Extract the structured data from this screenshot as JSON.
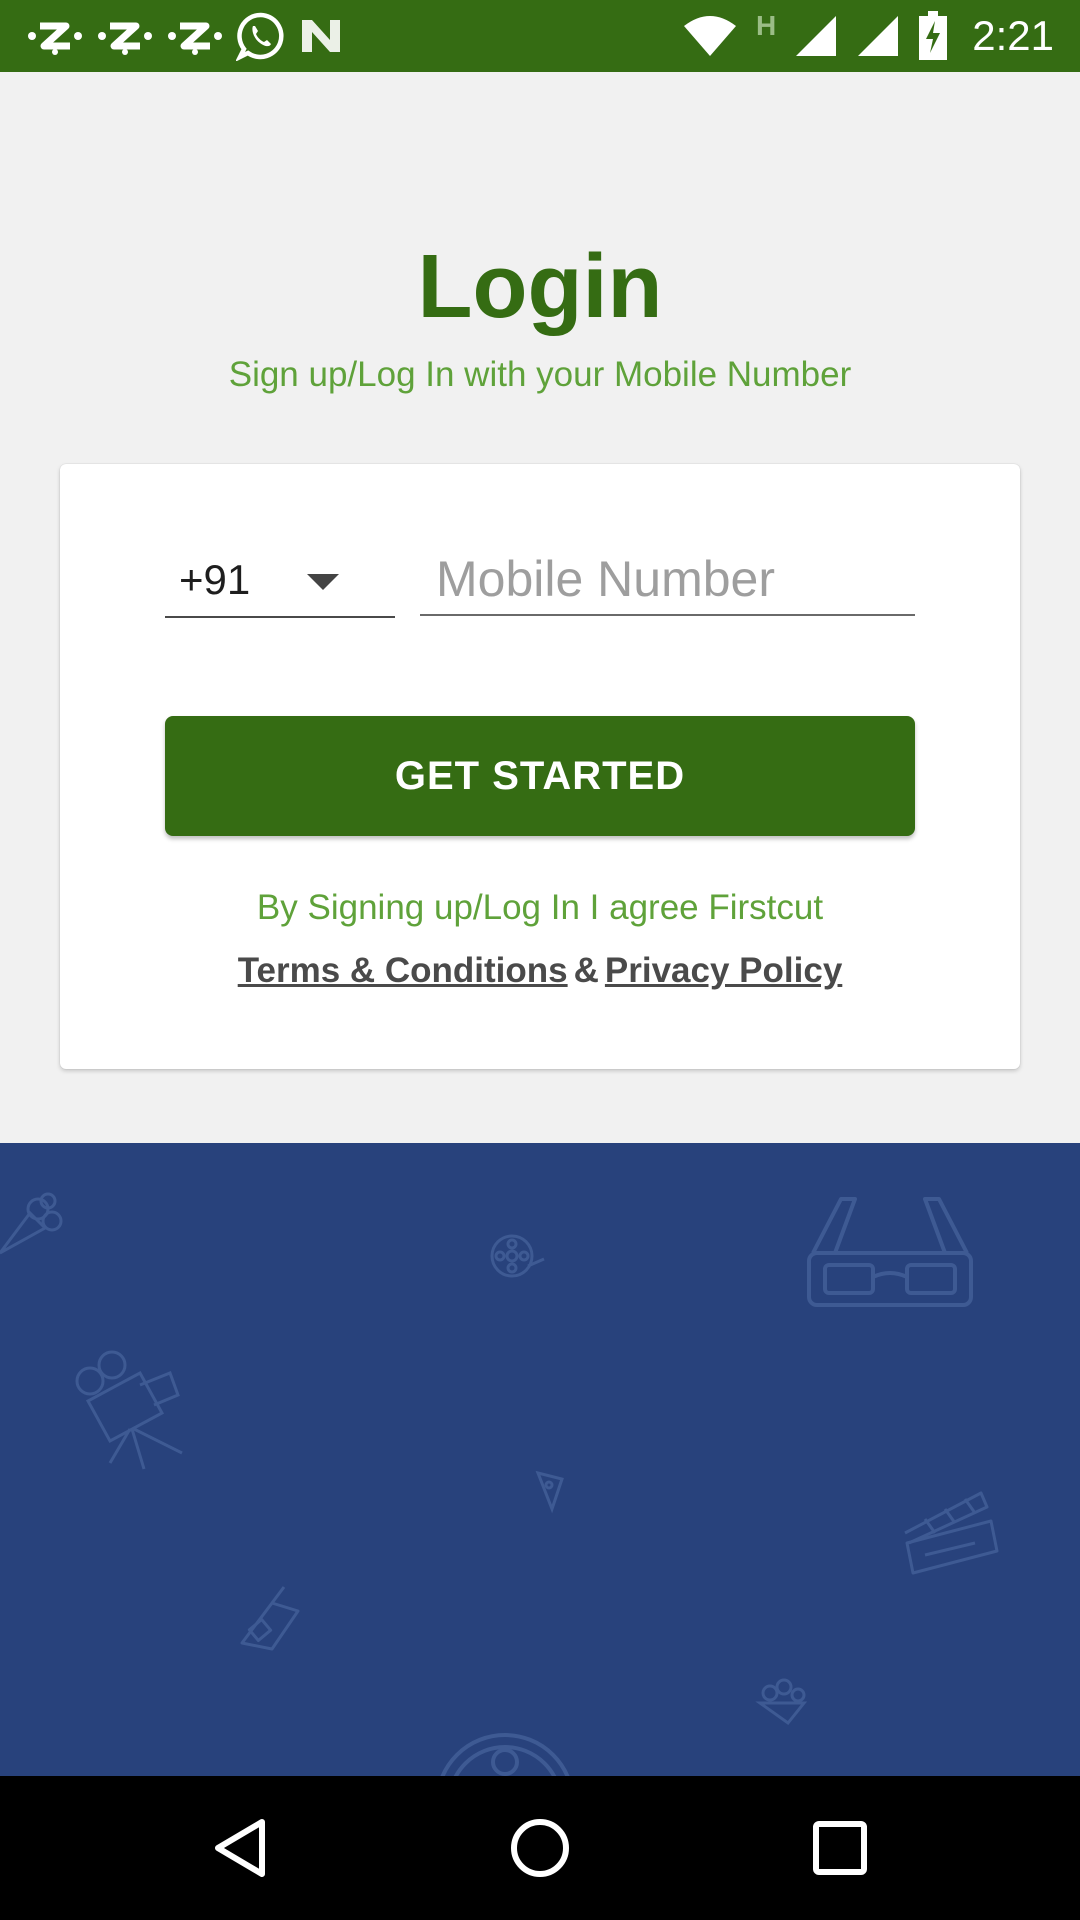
{
  "status_bar": {
    "time": "2:21",
    "network_label": "H",
    "notification_icons": [
      "z-app-icon",
      "z-app-icon",
      "z-app-icon",
      "whatsapp-icon",
      "n-app-icon"
    ],
    "system_icons": [
      "wifi-icon",
      "signal-icon",
      "signal-icon",
      "battery-charging-icon"
    ]
  },
  "header": {
    "title": "Login",
    "subtitle": "Sign up/Log In with your Mobile Number"
  },
  "form": {
    "country_code": "+91",
    "mobile_placeholder": "Mobile Number",
    "mobile_value": "",
    "submit_label": "GET STARTED",
    "agree_text": "By Signing up/Log In I agree Firstcut",
    "terms_label": "Terms & Conditions",
    "ampersand": "&",
    "privacy_label": "Privacy Policy"
  },
  "colors": {
    "primary_green": "#356c13",
    "light_green": "#5fa23a",
    "pattern_blue": "#28427c"
  },
  "nav_bar": {
    "icons": [
      "back-icon",
      "home-icon",
      "recents-icon"
    ]
  }
}
